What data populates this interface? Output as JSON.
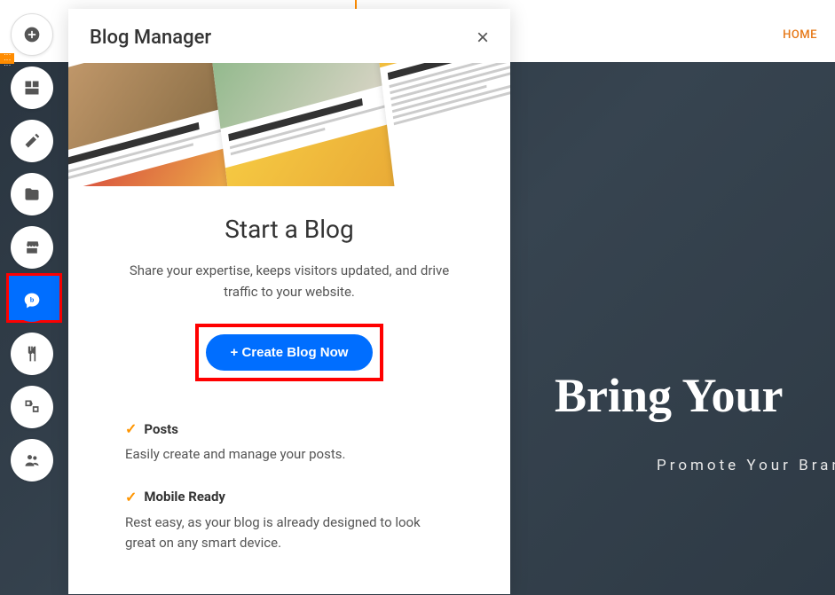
{
  "nav": {
    "home": "HOME"
  },
  "hero": {
    "title": "Bring Your",
    "subtitle": "Promote Your Bran"
  },
  "modal": {
    "title": "Blog Manager",
    "heading": "Start a Blog",
    "description": "Share your expertise, keeps visitors updated, and drive traffic to your website.",
    "create_button": "+ Create Blog Now"
  },
  "features": [
    {
      "name": "Posts",
      "description": "Easily create and manage your posts."
    },
    {
      "name": "Mobile Ready",
      "description": "Rest easy, as your blog is already designed to look great on any smart device."
    }
  ]
}
